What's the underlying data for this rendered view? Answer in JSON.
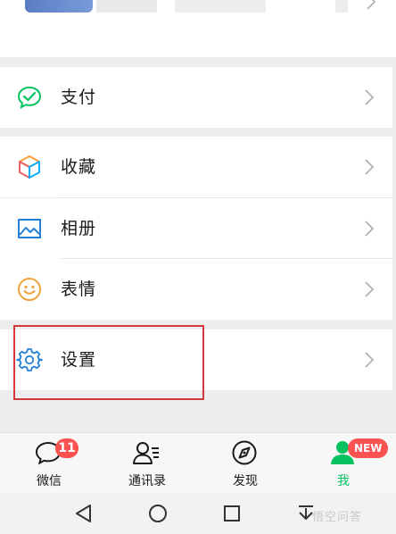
{
  "menu": {
    "items": [
      {
        "id": "pay",
        "label": "支付",
        "icon": "wechat-pay-icon"
      },
      {
        "id": "favorites",
        "label": "收藏",
        "icon": "favorites-cube-icon"
      },
      {
        "id": "album",
        "label": "相册",
        "icon": "album-picture-icon"
      },
      {
        "id": "stickers",
        "label": "表情",
        "icon": "sticker-smiley-icon"
      },
      {
        "id": "settings",
        "label": "设置",
        "icon": "gear-icon"
      }
    ]
  },
  "tabbar": {
    "tabs": [
      {
        "label": "微信",
        "icon": "chat-bubble-icon",
        "badge": "11",
        "active": false
      },
      {
        "label": "通讯录",
        "icon": "contacts-icon",
        "badge": "",
        "active": false
      },
      {
        "label": "发现",
        "icon": "compass-icon",
        "badge": "",
        "active": false
      },
      {
        "label": "我",
        "icon": "person-icon",
        "badge": "NEW",
        "active": true
      }
    ]
  },
  "navbar": {
    "buttons": [
      "back-triangle-icon",
      "home-circle-icon",
      "recent-square-icon",
      "notification-down-icon"
    ]
  },
  "watermark": "悟空问答",
  "colors": {
    "accent": "#07c160",
    "badge": "#fa5151",
    "highlight": "#d2393c",
    "background": "#ededed"
  }
}
